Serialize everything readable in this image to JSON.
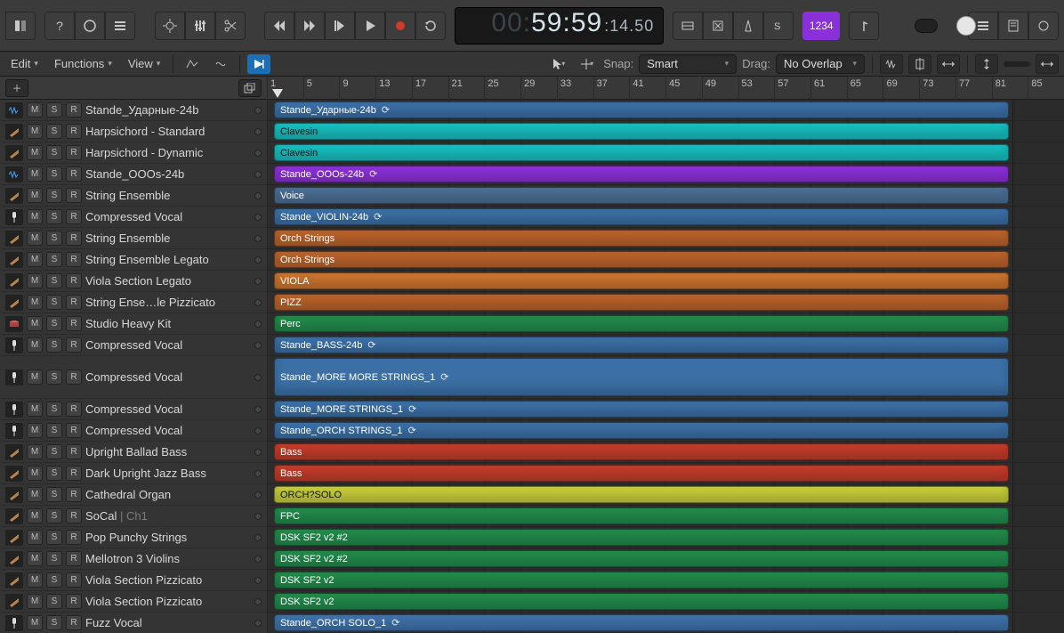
{
  "transport": {
    "time_dim": "00:",
    "time_big": "59:59",
    "time_small": ":14.50",
    "count_in": "1234"
  },
  "secbar": {
    "edit": "Edit",
    "functions": "Functions",
    "view": "View",
    "snap_label": "Snap:",
    "snap_value": "Smart",
    "drag_label": "Drag:",
    "drag_value": "No Overlap"
  },
  "ruler": {
    "bars": [
      "1",
      "5",
      "9",
      "13",
      "17",
      "21",
      "25",
      "29",
      "33",
      "37",
      "41",
      "45",
      "49",
      "53",
      "57",
      "61",
      "65",
      "69",
      "73",
      "77",
      "81",
      "85"
    ]
  },
  "tracks": [
    {
      "name": "Stande_Ударные-24b",
      "icon": "wave",
      "tall": false
    },
    {
      "name": "Harpsichord - Standard",
      "icon": "inst",
      "tall": false
    },
    {
      "name": "Harpsichord - Dynamic",
      "icon": "inst",
      "tall": false
    },
    {
      "name": "Stande_OOOs-24b",
      "icon": "wave",
      "tall": false
    },
    {
      "name": "String Ensemble",
      "icon": "inst",
      "tall": false
    },
    {
      "name": "Compressed Vocal",
      "icon": "mic",
      "tall": false
    },
    {
      "name": "String Ensemble",
      "icon": "inst",
      "tall": false
    },
    {
      "name": "String Ensemble Legato",
      "icon": "inst",
      "tall": false
    },
    {
      "name": "Viola Section Legato",
      "icon": "inst",
      "tall": false
    },
    {
      "name": "String Ense…le Pizzicato",
      "icon": "inst",
      "tall": false
    },
    {
      "name": "Studio Heavy Kit",
      "icon": "drum",
      "tall": false
    },
    {
      "name": "Compressed Vocal",
      "icon": "mic",
      "tall": false
    },
    {
      "name": "Compressed Vocal",
      "icon": "mic",
      "tall": true
    },
    {
      "name": "Compressed Vocal",
      "icon": "mic",
      "tall": false
    },
    {
      "name": "Compressed Vocal",
      "icon": "mic",
      "tall": false
    },
    {
      "name": "Upright Ballad Bass",
      "icon": "inst",
      "tall": false
    },
    {
      "name": "Dark Upright Jazz Bass",
      "icon": "inst",
      "tall": false
    },
    {
      "name": "Cathedral Organ",
      "icon": "inst",
      "tall": false
    },
    {
      "name": "SoCal",
      "sub": " | Ch1",
      "icon": "inst",
      "tall": false
    },
    {
      "name": "Pop Punchy Strings",
      "icon": "inst",
      "tall": false
    },
    {
      "name": "Mellotron 3 Violins",
      "icon": "inst",
      "tall": false
    },
    {
      "name": "Viola Section Pizzicato",
      "icon": "inst",
      "tall": false
    },
    {
      "name": "Viola Section Pizzicato",
      "icon": "inst",
      "tall": false
    },
    {
      "name": "Fuzz Vocal",
      "icon": "mic",
      "tall": false
    }
  ],
  "regions": [
    {
      "label": "Stande_Ударные-24b",
      "loop": true,
      "color": "c-blue",
      "tall": false
    },
    {
      "label": "Clavesin",
      "loop": false,
      "color": "c-teal",
      "dark": true,
      "tall": false
    },
    {
      "label": "Clavesin",
      "loop": false,
      "color": "c-teal",
      "dark": true,
      "tall": false
    },
    {
      "label": "Stande_OOOs-24b",
      "loop": true,
      "color": "c-purple",
      "tall": false
    },
    {
      "label": "Voice",
      "loop": false,
      "color": "c-bluegray",
      "tall": false
    },
    {
      "label": "Stande_VIOLIN-24b",
      "loop": true,
      "color": "c-blue",
      "tall": false
    },
    {
      "label": "Orch Strings",
      "loop": false,
      "color": "c-orange",
      "tall": false
    },
    {
      "label": "Orch Strings",
      "loop": false,
      "color": "c-orange",
      "tall": false
    },
    {
      "label": "VIOLA",
      "loop": false,
      "color": "c-orange2",
      "tall": false
    },
    {
      "label": "PIZZ",
      "loop": false,
      "color": "c-orange",
      "tall": false
    },
    {
      "label": "Perc",
      "loop": false,
      "color": "c-green",
      "tall": false
    },
    {
      "label": "Stande_BASS-24b",
      "loop": true,
      "color": "c-blue",
      "tall": false
    },
    {
      "label": "Stande_MORE MORE STRINGS_1",
      "loop": true,
      "color": "c-blue",
      "tall": true
    },
    {
      "label": "Stande_MORE STRINGS_1",
      "loop": true,
      "color": "c-blue",
      "tall": false
    },
    {
      "label": "Stande_ORCH STRINGS_1",
      "loop": true,
      "color": "c-blue",
      "tall": false
    },
    {
      "label": "Bass",
      "loop": false,
      "color": "c-red",
      "tall": false
    },
    {
      "label": "Bass",
      "loop": false,
      "color": "c-red",
      "tall": false
    },
    {
      "label": "ORCH?SOLO",
      "loop": false,
      "color": "c-yellow",
      "dark": true,
      "tall": false
    },
    {
      "label": "FPC",
      "loop": false,
      "color": "c-green",
      "tall": false
    },
    {
      "label": "DSK SF2 v2 #2",
      "loop": false,
      "color": "c-green",
      "tall": false
    },
    {
      "label": "DSK SF2 v2 #2",
      "loop": false,
      "color": "c-green",
      "tall": false
    },
    {
      "label": "DSK SF2 v2",
      "loop": false,
      "color": "c-green",
      "tall": false
    },
    {
      "label": "DSK SF2 v2",
      "loop": false,
      "color": "c-green",
      "tall": false
    },
    {
      "label": "Stande_ORCH SOLO_1",
      "loop": true,
      "color": "c-blue2",
      "tall": false
    }
  ],
  "msr_labels": {
    "mute": "M",
    "solo": "S",
    "input": "R"
  }
}
